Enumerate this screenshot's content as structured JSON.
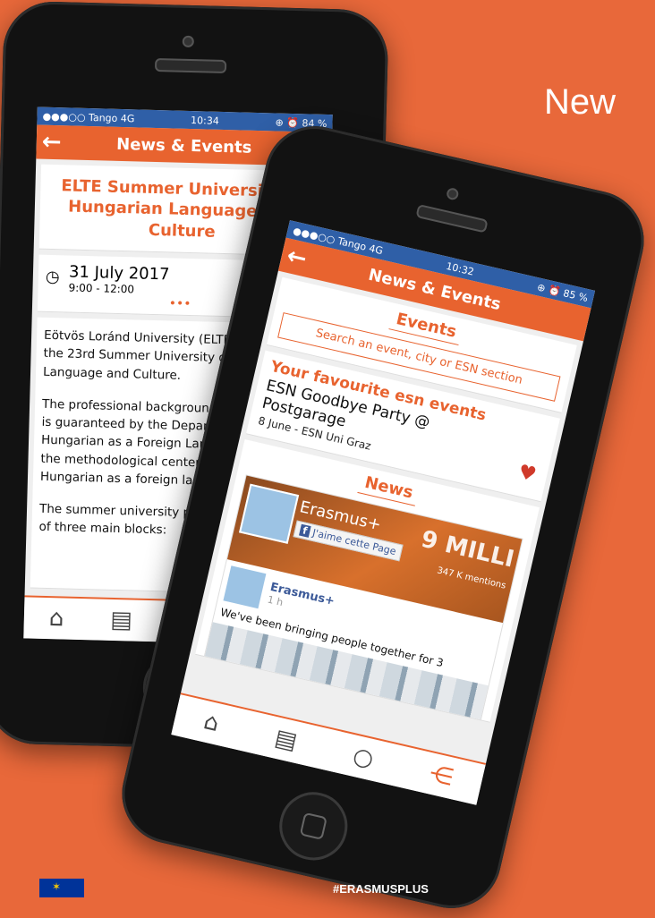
{
  "headline": "New",
  "phone_left": {
    "status": {
      "carrier": "●●●○○ Tango  4G",
      "time": "10:34",
      "battery": "⊕ ⏰ 84 %"
    },
    "appbar": {
      "title": "News & Events"
    },
    "event_title": "ELTE Summer University of Hungarian Language and Culture",
    "date": "31 July 2017",
    "time": "9:00 - 12:00",
    "more": "•••",
    "paragraphs": [
      "Eötvös Loránd University (ELTE) organizes the 23rd Summer University of Hungarian Language and Culture.",
      "The professional background of the program is guaranteed by the Department of Hungarian as a Foreign Language, which is the methodological center of teaching Hungarian as a foreign language.",
      "The summer university program is made up of three main blocks:"
    ]
  },
  "phone_right": {
    "status": {
      "carrier": "●●●○○ Tango  4G",
      "time": "10:32",
      "battery": "⊕ ⏰ 85 %"
    },
    "appbar": {
      "title": "News & Events"
    },
    "events_heading": "Events",
    "search_placeholder": "Search an event, city or ESN section",
    "favourites_heading": "Your favourite esn events",
    "event_name": "ESN Goodbye Party @ Postgarage",
    "event_meta": "8 June - ESN Uni Graz",
    "news_heading": "News",
    "fb": {
      "page_name": "Erasmus+",
      "like_label": "J'aime cette Page",
      "mentions": "347 K mentions",
      "banner_text": "9 MILLI",
      "post_author": "Erasmus+",
      "post_time": "1 h",
      "post_text": "We've been bringing people together for 3"
    }
  },
  "footer": {
    "hashtag": "#ERASMUSPLUS"
  }
}
